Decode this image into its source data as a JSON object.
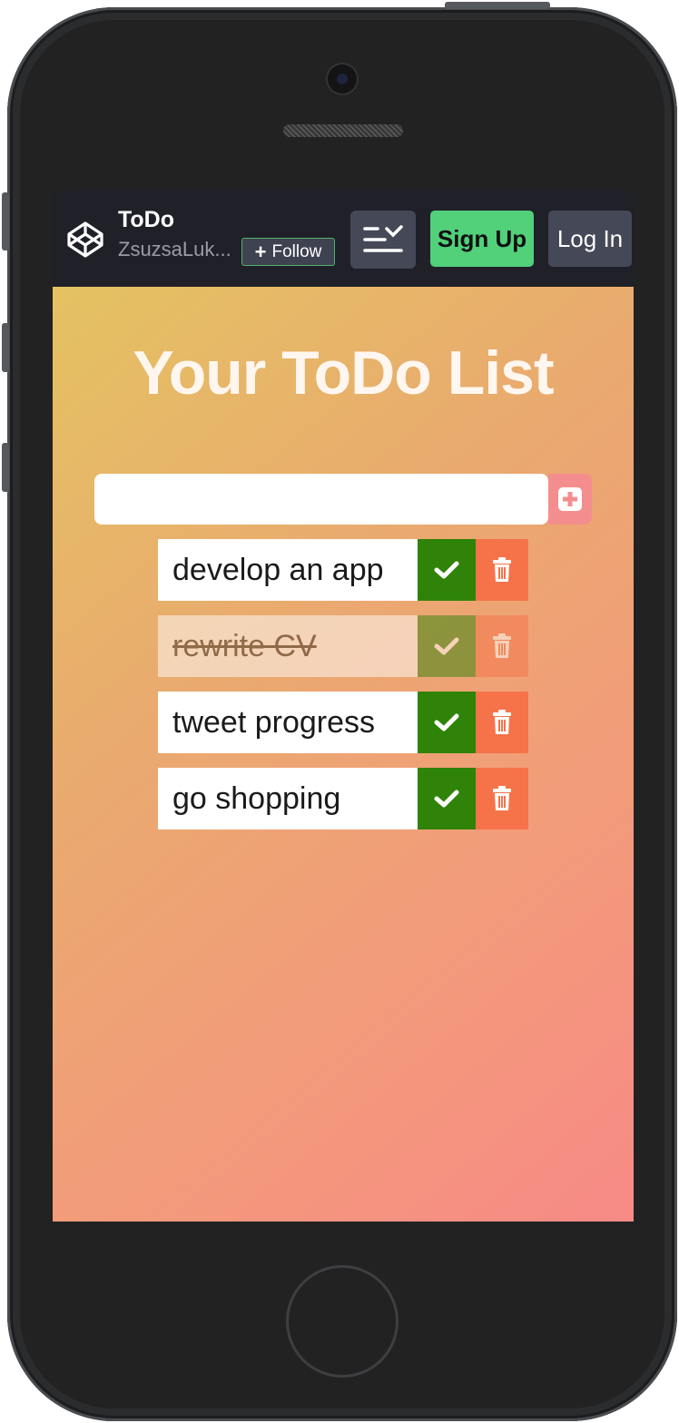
{
  "topbar": {
    "title": "ToDo",
    "user": "ZsuzsaLuk...",
    "follow_label": "Follow",
    "signup_label": "Sign Up",
    "login_label": "Log In"
  },
  "main": {
    "heading": "Your ToDo List",
    "input": {
      "value": "",
      "placeholder": ""
    },
    "todos": [
      {
        "text": "develop an app",
        "completed": false
      },
      {
        "text": "rewrite CV",
        "completed": true
      },
      {
        "text": "tweet progress",
        "completed": false
      },
      {
        "text": "go shopping",
        "completed": false
      }
    ]
  },
  "colors": {
    "topbar_bg": "#1f2028",
    "signup_green": "#52d07a",
    "check_green": "#2f8308",
    "trash_orange": "#f6734a",
    "add_pink": "#f48e8e",
    "gradient": [
      "#e4c262",
      "#e9ab6e",
      "#f39a7b",
      "#f78a86"
    ]
  },
  "icons": {
    "logo": "codepen-logo-icon",
    "menu": "menu-collapse-icon",
    "add": "plus-square-icon",
    "check": "check-icon",
    "trash": "trash-icon"
  }
}
